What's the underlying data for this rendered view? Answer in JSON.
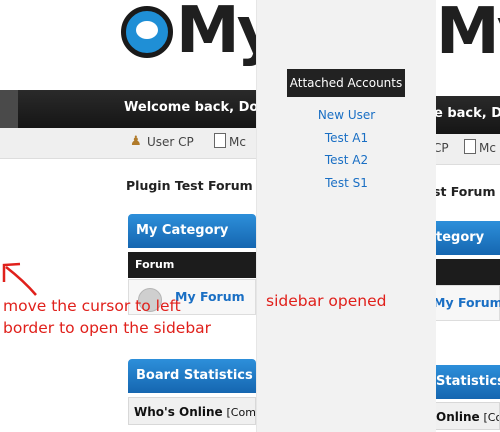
{
  "left": {
    "logo_text": "My",
    "welcome": "Welcome back, Doy",
    "nav": {
      "user_cp": "User CP",
      "memberlist": "Mc"
    },
    "forum_title": "Plugin Test Forum",
    "category": "My Category",
    "column": "Forum",
    "forum_link": "My Forum",
    "stats": "Board Statistics",
    "whos_online": "Who's Online",
    "online_extra": "[Comple"
  },
  "right": {
    "logo_text": "My",
    "welcome": "e back, Doy",
    "nav": {
      "user_cp": "CP",
      "memberlist": "Mc"
    },
    "forum_title": "st Forum",
    "category": "tegory",
    "forum_link": "My Forum",
    "stats": "Statistics",
    "whos_online": "Online",
    "online_extra": "[Comple"
  },
  "sidebar": {
    "title": "Attached Accounts",
    "accounts": [
      "New User",
      "Test A1",
      "Test A2",
      "Test S1"
    ]
  },
  "annotations": {
    "left_note_line1": "move the cursor to left",
    "left_note_line2": "border to open the sidebar",
    "sidebar_note": "sidebar opened"
  },
  "colors": {
    "accent": "#1f8fd6",
    "link": "#1a6fc4",
    "annotation": "#e0201b"
  }
}
